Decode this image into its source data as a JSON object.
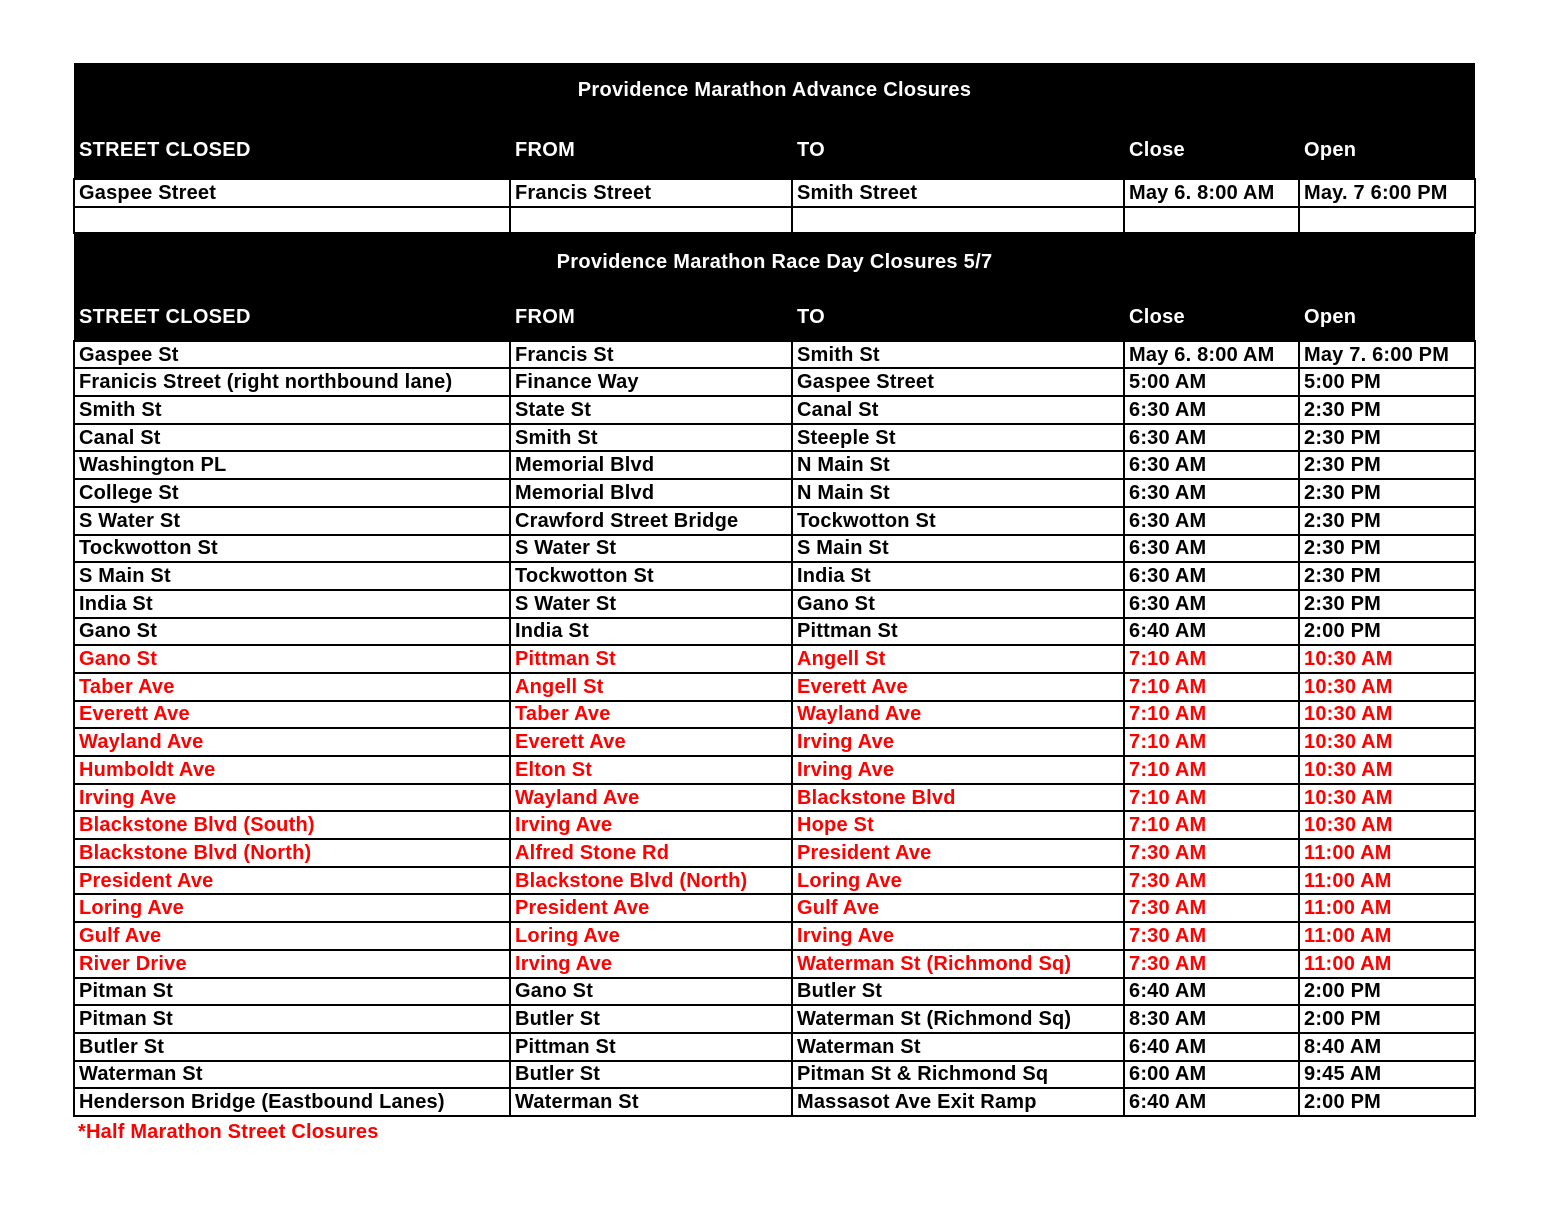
{
  "advance": {
    "title": "Providence Marathon Advance Closures",
    "headers": [
      "STREET CLOSED",
      "FROM",
      "TO",
      "Close",
      "Open"
    ],
    "rows": [
      {
        "street": "Gaspee Street",
        "from": "Francis Street",
        "to": "Smith Street",
        "close": "May 6. 8:00 AM",
        "open": "May. 7 6:00 PM",
        "half": false
      },
      {
        "street": "",
        "from": "",
        "to": "",
        "close": "",
        "open": "",
        "half": false
      }
    ]
  },
  "race_day": {
    "title": "Providence Marathon Race Day Closures 5/7",
    "headers": [
      "STREET CLOSED",
      "FROM",
      "TO",
      "Close",
      "Open"
    ],
    "rows": [
      {
        "street": "Gaspee St",
        "from": "Francis St",
        "to": "Smith St",
        "close": "May 6. 8:00 AM",
        "open": "May 7. 6:00 PM",
        "half": false
      },
      {
        "street": "Franicis Street (right northbound lane)",
        "from": "Finance Way",
        "to": "Gaspee Street",
        "close": "5:00 AM",
        "open": "5:00 PM",
        "half": false
      },
      {
        "street": "Smith St",
        "from": "State St",
        "to": "Canal St",
        "close": "6:30 AM",
        "open": "2:30 PM",
        "half": false
      },
      {
        "street": "Canal St",
        "from": "Smith St",
        "to": "Steeple St",
        "close": "6:30 AM",
        "open": "2:30 PM",
        "half": false
      },
      {
        "street": "Washington PL",
        "from": "Memorial Blvd",
        "to": "N Main St",
        "close": "6:30 AM",
        "open": "2:30 PM",
        "half": false
      },
      {
        "street": "College St",
        "from": "Memorial Blvd",
        "to": "N Main St",
        "close": "6:30 AM",
        "open": "2:30 PM",
        "half": false
      },
      {
        "street": "S Water St",
        "from": "Crawford Street Bridge",
        "to": "Tockwotton St",
        "close": "6:30 AM",
        "open": "2:30 PM",
        "half": false
      },
      {
        "street": "Tockwotton St",
        "from": "S Water St",
        "to": "S Main St",
        "close": "6:30 AM",
        "open": "2:30 PM",
        "half": false
      },
      {
        "street": "S Main St",
        "from": "Tockwotton St",
        "to": "India St",
        "close": "6:30 AM",
        "open": "2:30 PM",
        "half": false
      },
      {
        "street": "India St",
        "from": "S Water St",
        "to": "Gano St",
        "close": "6:30 AM",
        "open": "2:30 PM",
        "half": false
      },
      {
        "street": "Gano St",
        "from": "India St",
        "to": "Pittman St",
        "close": "6:40 AM",
        "open": "2:00 PM",
        "half": false
      },
      {
        "street": "Gano St",
        "from": "Pittman St",
        "to": "Angell St",
        "close": "7:10 AM",
        "open": "10:30 AM",
        "half": true
      },
      {
        "street": "Taber Ave",
        "from": "Angell St",
        "to": "Everett Ave",
        "close": "7:10 AM",
        "open": "10:30 AM",
        "half": true
      },
      {
        "street": "Everett Ave",
        "from": "Taber Ave",
        "to": "Wayland Ave",
        "close": "7:10 AM",
        "open": "10:30 AM",
        "half": true
      },
      {
        "street": "Wayland Ave",
        "from": "Everett Ave",
        "to": "Irving Ave",
        "close": "7:10 AM",
        "open": "10:30 AM",
        "half": true
      },
      {
        "street": "Humboldt Ave",
        "from": "Elton St",
        "to": "Irving Ave",
        "close": "7:10 AM",
        "open": "10:30 AM",
        "half": true
      },
      {
        "street": "Irving Ave",
        "from": "Wayland Ave",
        "to": "Blackstone Blvd",
        "close": "7:10 AM",
        "open": "10:30 AM",
        "half": true
      },
      {
        "street": "Blackstone Blvd (South)",
        "from": "Irving Ave",
        "to": "Hope St",
        "close": "7:10 AM",
        "open": "10:30 AM",
        "half": true
      },
      {
        "street": "Blackstone Blvd (North)",
        "from": "Alfred Stone Rd",
        "to": "President Ave",
        "close": "7:30 AM",
        "open": "11:00 AM",
        "half": true
      },
      {
        "street": "President Ave",
        "from": "Blackstone Blvd (North)",
        "to": "Loring Ave",
        "close": "7:30 AM",
        "open": "11:00 AM",
        "half": true
      },
      {
        "street": "Loring Ave",
        "from": "President Ave",
        "to": "Gulf Ave",
        "close": "7:30 AM",
        "open": "11:00 AM",
        "half": true
      },
      {
        "street": "Gulf Ave",
        "from": "Loring Ave",
        "to": "Irving Ave",
        "close": "7:30 AM",
        "open": "11:00 AM",
        "half": true
      },
      {
        "street": "River Drive",
        "from": "Irving Ave",
        "to": "Waterman St (Richmond Sq)",
        "close": "7:30 AM",
        "open": "11:00 AM",
        "half": true
      },
      {
        "street": "Pitman St",
        "from": "Gano St",
        "to": "Butler St",
        "close": "6:40 AM",
        "open": "2:00 PM",
        "half": false
      },
      {
        "street": "Pitman St",
        "from": "Butler St",
        "to": "Waterman St (Richmond Sq)",
        "close": "8:30 AM",
        "open": "2:00 PM",
        "half": false
      },
      {
        "street": "Butler St",
        "from": "Pittman St",
        "to": "Waterman St",
        "close": "6:40 AM",
        "open": "8:40 AM",
        "half": false
      },
      {
        "street": "Waterman St",
        "from": "Butler St",
        "to": "Pitman St & Richmond Sq",
        "close": "6:00 AM",
        "open": "9:45 AM",
        "half": false
      },
      {
        "street": "Henderson Bridge (Eastbound Lanes)",
        "from": "Waterman St",
        "to": "Massasot Ave Exit Ramp",
        "close": "6:40 AM",
        "open": "2:00 PM",
        "half": false
      }
    ]
  },
  "footnote": "*Half Marathon Street Closures",
  "colors": {
    "header_bg": "#000000",
    "header_text": "#ffffff",
    "normal_text": "#000000",
    "half_marathon_text": "#ff0000"
  }
}
